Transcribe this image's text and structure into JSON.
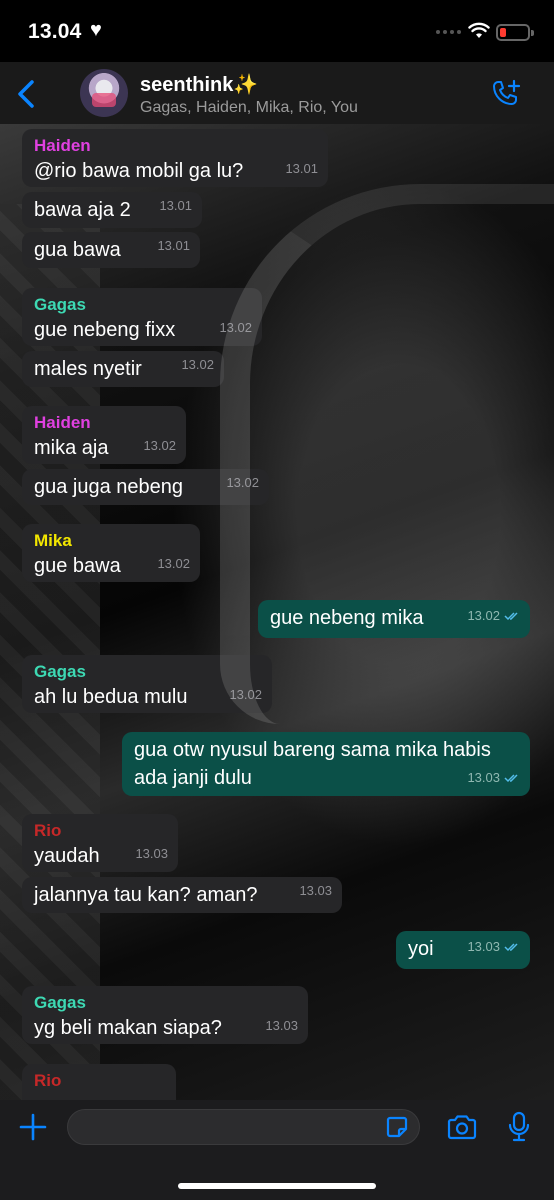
{
  "status_bar": {
    "time": "13.04"
  },
  "header": {
    "group_name": "seenthink✨",
    "members": "Gagas, Haiden, Mika, Rio, You"
  },
  "messages": [
    {
      "sender": "Haiden",
      "text": "@rio bawa mobil ga lu?",
      "time": "13.01"
    },
    {
      "text": "bawa aja 2",
      "time": "13.01"
    },
    {
      "text": "gua bawa",
      "time": "13.01"
    },
    {
      "sender": "Gagas",
      "text": "gue nebeng fixx",
      "time": "13.02"
    },
    {
      "text": "males nyetir",
      "time": "13.02"
    },
    {
      "sender": "Haiden",
      "text": "mika aja",
      "time": "13.02"
    },
    {
      "text": "gua juga nebeng",
      "time": "13.02"
    },
    {
      "sender": "Mika",
      "text": "gue bawa",
      "time": "13.02"
    },
    {
      "text": "gue nebeng mika",
      "time": "13.02"
    },
    {
      "sender": "Gagas",
      "text": "ah lu bedua mulu",
      "time": "13.02"
    },
    {
      "text": "gua otw nyusul bareng sama mika habis ada janji dulu",
      "time": "13.03"
    },
    {
      "sender": "Rio",
      "text": "yaudah",
      "time": "13.03"
    },
    {
      "text": "jalannya tau kan? aman?",
      "time": "13.03"
    },
    {
      "text": "yoi",
      "time": "13.03"
    },
    {
      "sender": "Gagas",
      "text": "yg beli makan siapa?",
      "time": "13.03"
    },
    {
      "sender": "Rio",
      "text": ""
    }
  ],
  "colors": {
    "haiden": "#e040e0",
    "gagas": "#3dd9b3",
    "mika": "#f2e600",
    "rio": "#c62828",
    "accent": "#0a84ff",
    "outgoing_bubble": "#0b5048",
    "incoming_bubble": "#262628",
    "read_ticks": "#53bdeb"
  },
  "icons": {
    "back": "chevron-left-icon",
    "add_call": "phone-plus-icon",
    "plus": "plus-icon",
    "sticker": "sticker-icon",
    "camera": "camera-icon",
    "mic": "microphone-icon",
    "heart": "heart-icon",
    "wifi": "wifi-icon",
    "battery": "battery-low-icon"
  }
}
